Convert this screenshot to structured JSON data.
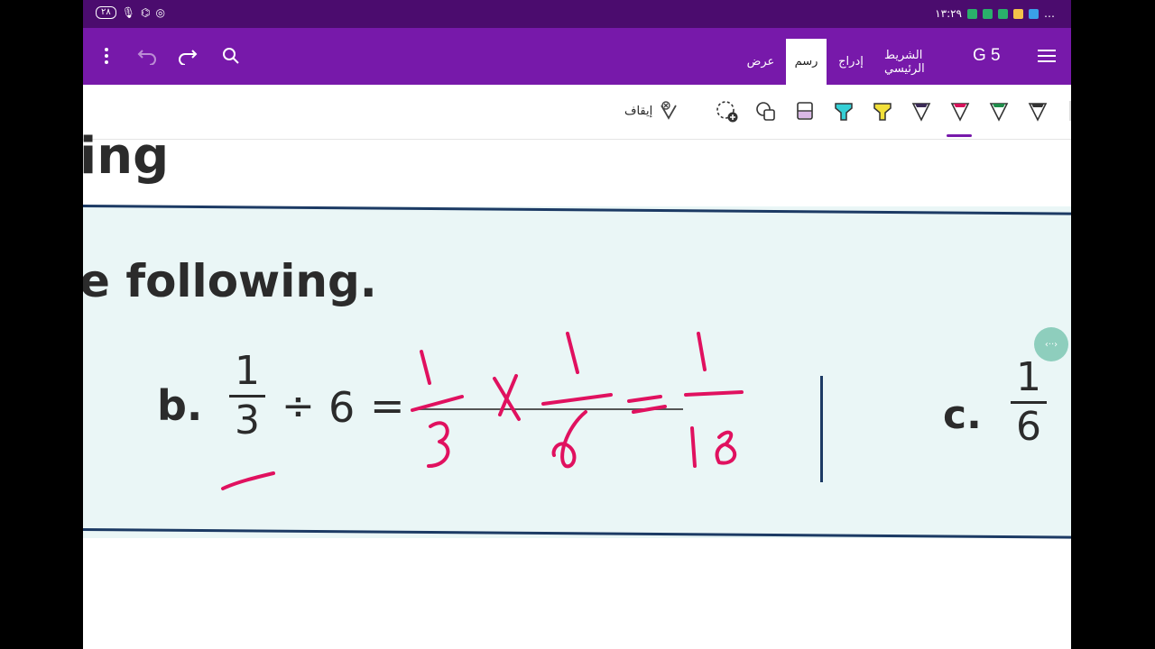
{
  "status_bar": {
    "time": "١٣:٢٩",
    "battery": "٢٨",
    "more": "…"
  },
  "ribbon": {
    "notebook_title": "G 5",
    "tabs": [
      {
        "label": "الشريط الرئيسي"
      },
      {
        "label": "إدراج"
      },
      {
        "label": "رسم"
      },
      {
        "label": "عرض"
      }
    ],
    "active_tab": "رسم"
  },
  "draw_toolbar": {
    "stop_label": "إيقاف",
    "pens": [
      {
        "color": "#333333"
      },
      {
        "color": "#1e8c4a"
      },
      {
        "color": "#d6115a"
      },
      {
        "color": "#3a2a55"
      },
      {
        "color": "#f2e03a"
      },
      {
        "color": "#35d0d6"
      },
      {
        "color": "#d9b8e6"
      }
    ],
    "selected_pen_color": "#d6115a"
  },
  "page": {
    "heading_fragment": "ing",
    "instruction_fragment": "e following.",
    "problem_b": {
      "label": "b.",
      "numerator": "1",
      "denominator": "3",
      "operator": "÷",
      "operand": "6",
      "equals": "="
    },
    "problem_c": {
      "label": "c.",
      "numerator": "1",
      "denominator": "6"
    },
    "ink_note": [
      "1",
      "3",
      "x",
      "1",
      "6",
      "=",
      "1",
      "18"
    ],
    "ink_color": "#e0115f"
  }
}
